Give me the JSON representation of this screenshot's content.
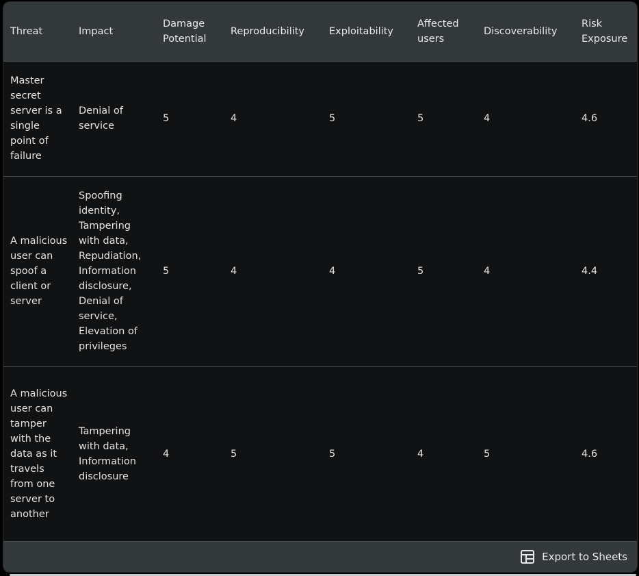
{
  "table": {
    "headers": [
      "Threat",
      "Impact",
      "Damage Potential",
      "Reproducibility",
      "Exploitability",
      "Affected users",
      "Discoverability",
      "Risk Exposure"
    ],
    "rows": [
      {
        "threat": "Master secret server is a single point of failure",
        "impact": "Denial of service",
        "damage_potential": "5",
        "reproducibility": "4",
        "exploitability": "5",
        "affected_users": "5",
        "discoverability": "4",
        "risk_exposure": "4.6"
      },
      {
        "threat": "A malicious user can spoof a client or server",
        "impact": "Spoofing identity, Tampering with data, Repudiation, Information disclosure, Denial of service, Elevation of privileges",
        "damage_potential": "5",
        "reproducibility": "4",
        "exploitability": "4",
        "affected_users": "5",
        "discoverability": "4",
        "risk_exposure": "4.4"
      },
      {
        "threat": "A malicious user can tamper with the data as it travels from one server to another",
        "impact": "Tampering with data, Information disclosure",
        "damage_potential": "4",
        "reproducibility": "5",
        "exploitability": "5",
        "affected_users": "4",
        "discoverability": "5",
        "risk_exposure": "4.6"
      }
    ]
  },
  "footer": {
    "export_label": "Export to Sheets",
    "export_icon": "sheets-table-icon"
  },
  "colors": {
    "background": "#101213",
    "header_bg": "#33383b",
    "text": "#e3e3e3",
    "divider": "#4a4e51"
  }
}
